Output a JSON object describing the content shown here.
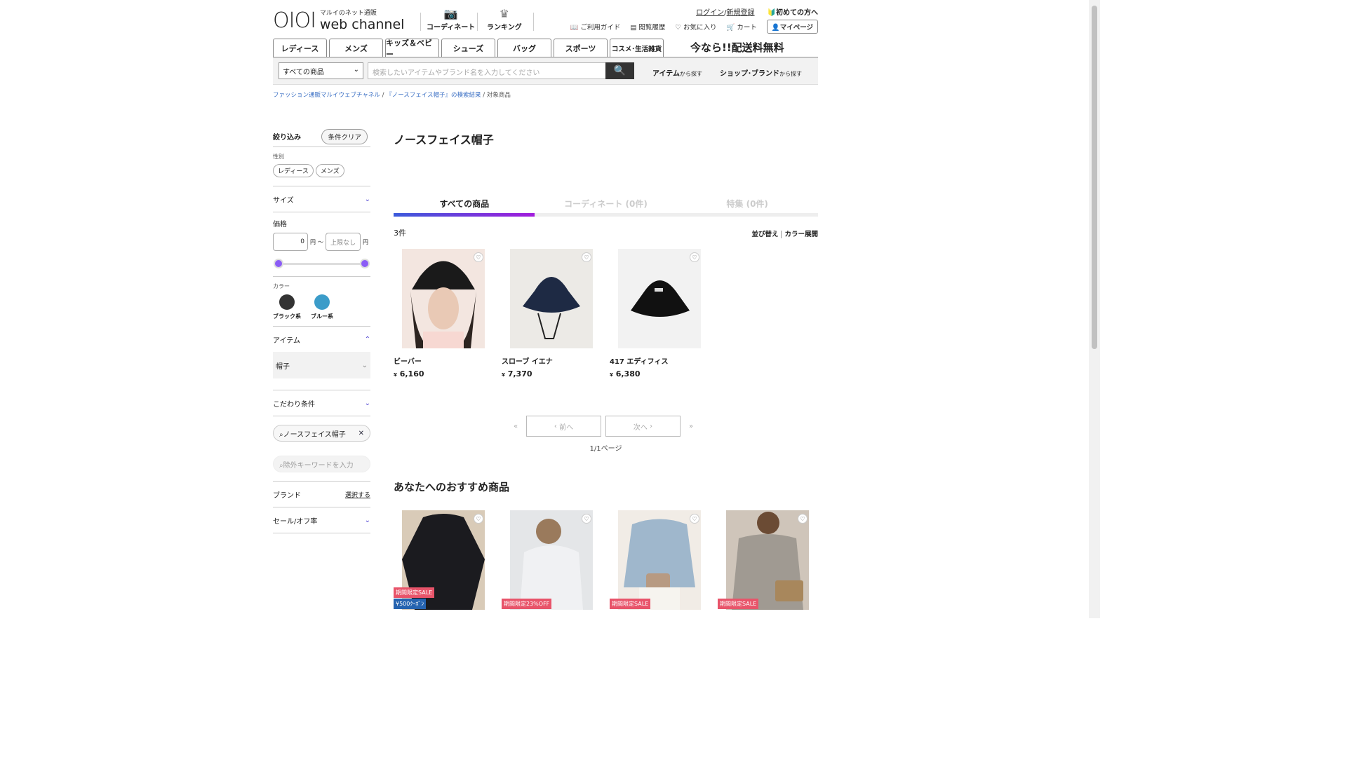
{
  "header": {
    "logo_sub": "マルイのネット通販",
    "logo_main": "web channel",
    "nav": [
      {
        "label": "コーディネート",
        "icon": "camera-icon"
      },
      {
        "label": "ランキング",
        "icon": "crown-icon"
      }
    ],
    "login": "ログイン",
    "register": "新規登録",
    "first_time": "初めての方へ",
    "guide": "ご利用ガイド",
    "history": "閲覧履歴",
    "favorites": "お気に入り",
    "cart": "カート",
    "mypage": "マイページ",
    "categories": [
      "レディース",
      "メンズ",
      "キッズ＆ベビー",
      "シューズ",
      "バッグ",
      "スポーツ",
      "コスメ･生活雑貨"
    ],
    "promo": "今なら!!配送料無料",
    "search_select": "すべての商品",
    "search_placeholder": "検索したいアイテムやブランド名を入力してください",
    "item_link": "アイテム",
    "shop_link": "ショップ･ブランド",
    "from_search": "から探す"
  },
  "breadcrumb": [
    "ファッション通販マルイウェブチャネル",
    "『ノースフェイス帽子』の検索結果",
    "対象商品"
  ],
  "sidebar": {
    "title": "絞り込み",
    "clear": "条件クリア",
    "gender_label": "性別",
    "genders": [
      "レディース",
      "メンズ"
    ],
    "size": "サイズ",
    "price": "価格",
    "price_min": "0",
    "price_max_placeholder": "上限なし",
    "yen": "円",
    "tilde": "～",
    "color_label": "カラー",
    "colors": [
      {
        "name": "ブラック系",
        "hex": "#333333"
      },
      {
        "name": "ブルー系",
        "hex": "#3b9cc9"
      }
    ],
    "item": "アイテム",
    "item_value": "帽子",
    "kodawari": "こだわり条件",
    "keyword": "ノースフェイス帽子",
    "exclude_placeholder": "除外キーワードを入力",
    "brand": "ブランド",
    "brand_select": "選択する",
    "sale": "セール/オフ率"
  },
  "main": {
    "title": "ノースフェイス帽子",
    "tabs": [
      "すべての商品",
      "コーディネート (0件)",
      "特集 (0件)"
    ],
    "count": "3件",
    "sort": "並び替え",
    "color_expand": "カラー展開",
    "products": [
      {
        "name": "ビーバー",
        "price": "6,160"
      },
      {
        "name": "スローブ イエナ",
        "price": "7,370"
      },
      {
        "name": "417 エディフィス",
        "price": "6,380"
      }
    ],
    "yen_mark": "¥",
    "prev": "前へ",
    "next": "次へ",
    "page_info": "1/1ページ",
    "rec_title": "あなたへのおすすめ商品",
    "rec_badges": [
      "期間限定SALE",
      "期間限定23%OFF",
      "期間限定SALE",
      "期間限定SALE"
    ],
    "coupon": "¥500ｸｰﾎﾟﾝ"
  },
  "colors": {
    "accent": "#8b5cf6",
    "link": "#3a6fc4",
    "sale": "#e8546a"
  }
}
